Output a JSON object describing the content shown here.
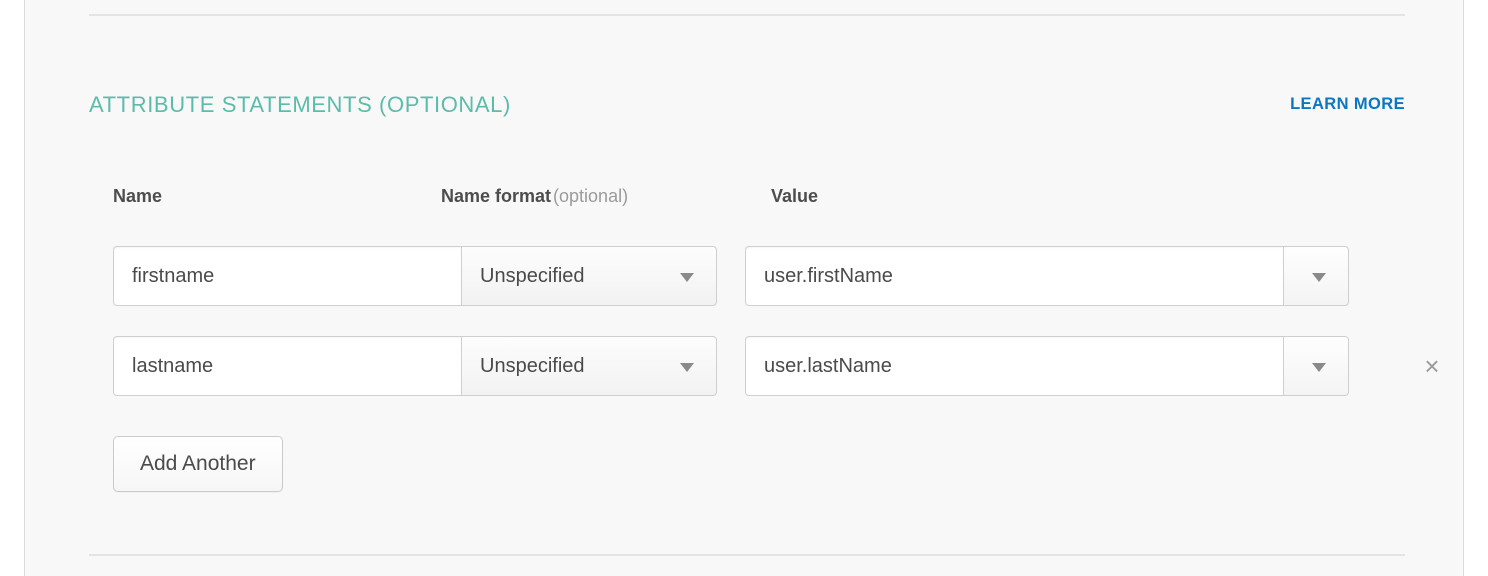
{
  "section": {
    "title": "ATTRIBUTE STATEMENTS (OPTIONAL)",
    "learn_more": "LEARN MORE",
    "title_color": "#5cbcaa",
    "link_color": "#0a77c0"
  },
  "columns": {
    "name": "Name",
    "name_format": "Name format",
    "name_format_optional": "(optional)",
    "value": "Value"
  },
  "rows": [
    {
      "name_value": "firstname",
      "name_placeholder": "",
      "format_selected": "Unspecified",
      "format_caret": "chevron-down-icon",
      "value_value": "user.firstName",
      "value_placeholder": "",
      "value_caret": "chevron-down-icon",
      "removable": false,
      "remove_label": ""
    },
    {
      "name_value": "lastname",
      "name_placeholder": "",
      "format_selected": "Unspecified",
      "format_caret": "chevron-down-icon",
      "value_value": "user.lastName",
      "value_placeholder": "",
      "value_caret": "chevron-down-icon",
      "removable": true,
      "remove_label": "×"
    }
  ],
  "buttons": {
    "add_another": "Add Another"
  }
}
